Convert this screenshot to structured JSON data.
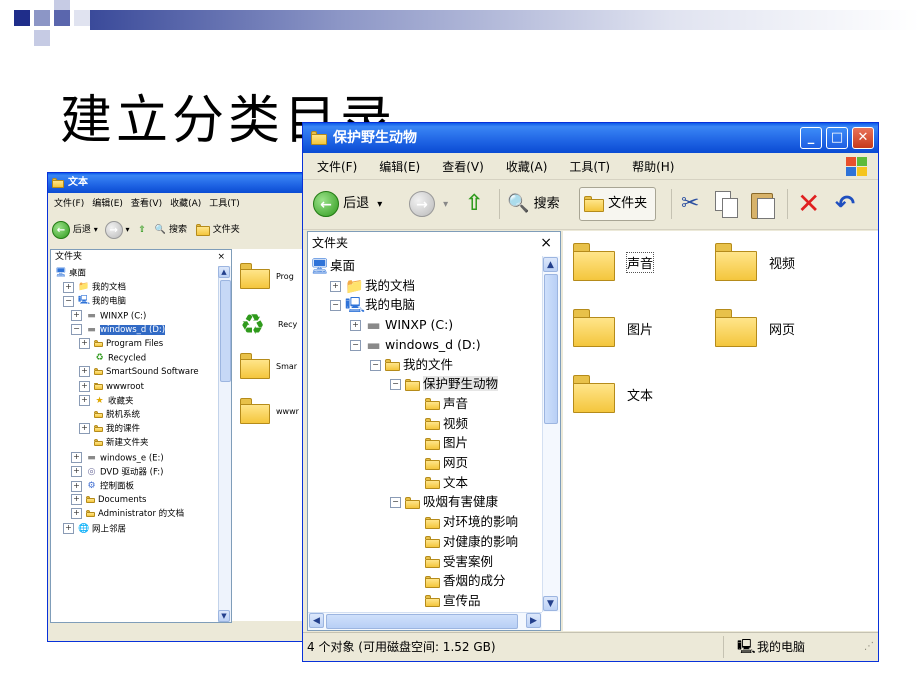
{
  "slide": {
    "title": "建立分类目录"
  },
  "left_window": {
    "title": "文本",
    "menu": [
      "文件(F)",
      "编辑(E)",
      "查看(V)",
      "收藏(A)",
      "工具(T)"
    ],
    "toolbar": {
      "back": "后退",
      "search": "搜索",
      "folders": "文件夹"
    },
    "pane_title": "文件夹",
    "pane_close": "×",
    "tree": [
      {
        "label": "桌面",
        "level": 0,
        "icon": "desktop-icon"
      },
      {
        "label": "我的文档",
        "level": 1,
        "icon": "documents-icon",
        "exp": "+"
      },
      {
        "label": "我的电脑",
        "level": 1,
        "icon": "computer-icon",
        "exp": "-"
      },
      {
        "label": "WINXP (C:)",
        "level": 2,
        "icon": "drive-icon",
        "exp": "+"
      },
      {
        "label": "windows_d (D:)",
        "level": 2,
        "icon": "drive-icon",
        "exp": "-",
        "selected": true
      },
      {
        "label": "Program Files",
        "level": 3,
        "icon": "folder-icon",
        "exp": "+"
      },
      {
        "label": "Recycled",
        "level": 3,
        "icon": "recycle-icon"
      },
      {
        "label": "SmartSound Software",
        "level": 3,
        "icon": "folder-icon",
        "exp": "+"
      },
      {
        "label": "wwwroot",
        "level": 3,
        "icon": "folder-icon",
        "exp": "+"
      },
      {
        "label": "收藏夹",
        "level": 3,
        "icon": "favorites-icon",
        "exp": "+"
      },
      {
        "label": "脱机系统",
        "level": 3,
        "icon": "folder-icon"
      },
      {
        "label": "我的课件",
        "level": 3,
        "icon": "folder-icon",
        "exp": "+"
      },
      {
        "label": "新建文件夹",
        "level": 3,
        "icon": "folder-icon"
      },
      {
        "label": "windows_e (E:)",
        "level": 2,
        "icon": "drive-icon",
        "exp": "+"
      },
      {
        "label": "DVD 驱动器 (F:)",
        "level": 2,
        "icon": "dvd-icon",
        "exp": "+"
      },
      {
        "label": "控制面板",
        "level": 2,
        "icon": "control-panel-icon",
        "exp": "+"
      },
      {
        "label": "Documents",
        "level": 2,
        "icon": "folder-icon",
        "exp": "+"
      },
      {
        "label": "Administrator 的文档",
        "level": 2,
        "icon": "folder-icon",
        "exp": "+"
      },
      {
        "label": "网上邻居",
        "level": 1,
        "icon": "network-icon",
        "exp": "+"
      }
    ],
    "right_items": [
      "Prog",
      "Recy",
      "Smar",
      "wwwr"
    ]
  },
  "main_window": {
    "title": "保护野生动物",
    "menu": [
      "文件(F)",
      "编辑(E)",
      "查看(V)",
      "收藏(A)",
      "工具(T)",
      "帮助(H)"
    ],
    "toolbar": {
      "back": "后退",
      "search": "搜索",
      "folders": "文件夹"
    },
    "pane_title": "文件夹",
    "pane_close": "×",
    "tree": [
      {
        "label": "桌面",
        "level": 0,
        "icon": "desktop-icon"
      },
      {
        "label": "我的文档",
        "level": 1,
        "icon": "documents-icon",
        "exp": "+"
      },
      {
        "label": "我的电脑",
        "level": 1,
        "icon": "computer-icon",
        "exp": "-"
      },
      {
        "label": "WINXP (C:)",
        "level": 2,
        "icon": "drive-icon",
        "exp": "+"
      },
      {
        "label": "windows_d (D:)",
        "level": 2,
        "icon": "drive-icon",
        "exp": "-"
      },
      {
        "label": "我的文件",
        "level": 3,
        "icon": "folder-icon",
        "exp": "-"
      },
      {
        "label": "保护野生动物",
        "level": 4,
        "icon": "folder-icon",
        "exp": "-",
        "selected": true
      },
      {
        "label": "声音",
        "level": 5,
        "icon": "folder-icon"
      },
      {
        "label": "视频",
        "level": 5,
        "icon": "folder-icon"
      },
      {
        "label": "图片",
        "level": 5,
        "icon": "folder-icon"
      },
      {
        "label": "网页",
        "level": 5,
        "icon": "folder-icon"
      },
      {
        "label": "文本",
        "level": 5,
        "icon": "folder-icon"
      },
      {
        "label": "吸烟有害健康",
        "level": 4,
        "icon": "folder-icon",
        "exp": "-"
      },
      {
        "label": "对环境的影响",
        "level": 5,
        "icon": "folder-icon"
      },
      {
        "label": "对健康的影响",
        "level": 5,
        "icon": "folder-icon"
      },
      {
        "label": "受害案例",
        "level": 5,
        "icon": "folder-icon"
      },
      {
        "label": "香烟的成分",
        "level": 5,
        "icon": "folder-icon"
      },
      {
        "label": "宣传品",
        "level": 5,
        "icon": "folder-icon"
      }
    ],
    "content": [
      {
        "label": "声音"
      },
      {
        "label": "视频"
      },
      {
        "label": "图片"
      },
      {
        "label": "网页"
      },
      {
        "label": "文本"
      }
    ],
    "status": {
      "left": "4 个对象 (可用磁盘空间: 1.52 GB)",
      "right": "我的电脑"
    }
  }
}
